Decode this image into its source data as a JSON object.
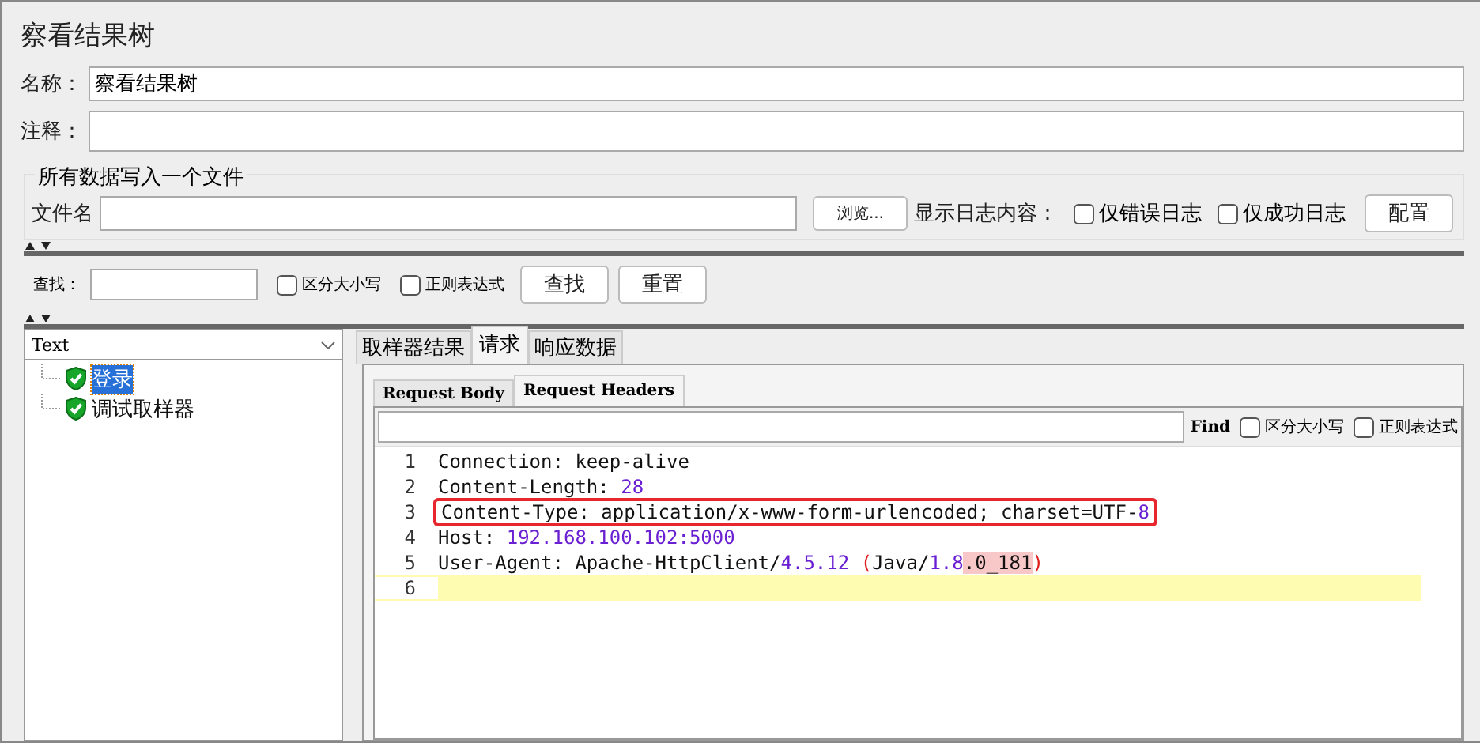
{
  "title": "察看结果树",
  "name_field": {
    "label": "名称：",
    "value": "察看结果树"
  },
  "comment_field": {
    "label": "注释："
  },
  "file_group": {
    "legend": "所有数据写入一个文件",
    "label": "文件名",
    "browse": "浏览...",
    "log_label": "显示日志内容：",
    "options": [
      {
        "label": "仅错误日志",
        "checked": false
      },
      {
        "label": "仅成功日志",
        "checked": false
      }
    ],
    "config": "配置"
  },
  "search": {
    "label": "查找：",
    "options": [
      {
        "label": "区分大小写",
        "checked": false
      },
      {
        "label": "正则表达式",
        "checked": false
      }
    ],
    "buttons": [
      "查找",
      "重置"
    ]
  },
  "renderer": "Text",
  "tree": [
    {
      "label": "登录",
      "selected": true
    },
    {
      "label": "调试取样器",
      "selected": false
    }
  ],
  "tabs": [
    {
      "label": "取样器结果",
      "selected": false
    },
    {
      "label": "请求",
      "selected": true
    },
    {
      "label": "响应数据",
      "selected": false
    }
  ],
  "subtabs": [
    {
      "label": "Request Body",
      "selected": false
    },
    {
      "label": "Request Headers",
      "selected": true
    }
  ],
  "find": {
    "label": "Find",
    "options": [
      {
        "label": "区分大小写",
        "checked": false
      },
      {
        "label": "正则表达式",
        "checked": false
      }
    ]
  },
  "lines": [
    {
      "number": "1",
      "current": false,
      "segments": [
        {
          "kind": "plain",
          "text": "Connection: keep-alive"
        }
      ]
    },
    {
      "number": "2",
      "current": false,
      "segments": [
        {
          "kind": "plain",
          "text": "Content-Length: "
        },
        {
          "kind": "number",
          "text": "28"
        }
      ]
    },
    {
      "number": "3",
      "boxed": true,
      "current": false,
      "segments": [
        {
          "kind": "plain",
          "text": "Content-Type: application/x-www-form-urlencoded; charset=UTF-"
        },
        {
          "kind": "number",
          "text": "8"
        }
      ]
    },
    {
      "number": "4",
      "current": false,
      "segments": [
        {
          "kind": "plain",
          "text": "Host: "
        },
        {
          "kind": "number",
          "text": "192.168.100.102:5000"
        }
      ]
    },
    {
      "number": "5",
      "current": false,
      "segments": [
        {
          "kind": "plain",
          "text": "User-Agent: Apache-HttpClient/"
        },
        {
          "kind": "number",
          "text": "4.5.12"
        },
        {
          "kind": "paren",
          "text": " ("
        },
        {
          "kind": "plain",
          "text": "Java/"
        },
        {
          "kind": "number",
          "text": "1.8"
        },
        {
          "kind": "match",
          "text": ".0_181"
        },
        {
          "kind": "paren",
          "text": ")"
        }
      ]
    },
    {
      "number": "6",
      "current": true
    }
  ]
}
